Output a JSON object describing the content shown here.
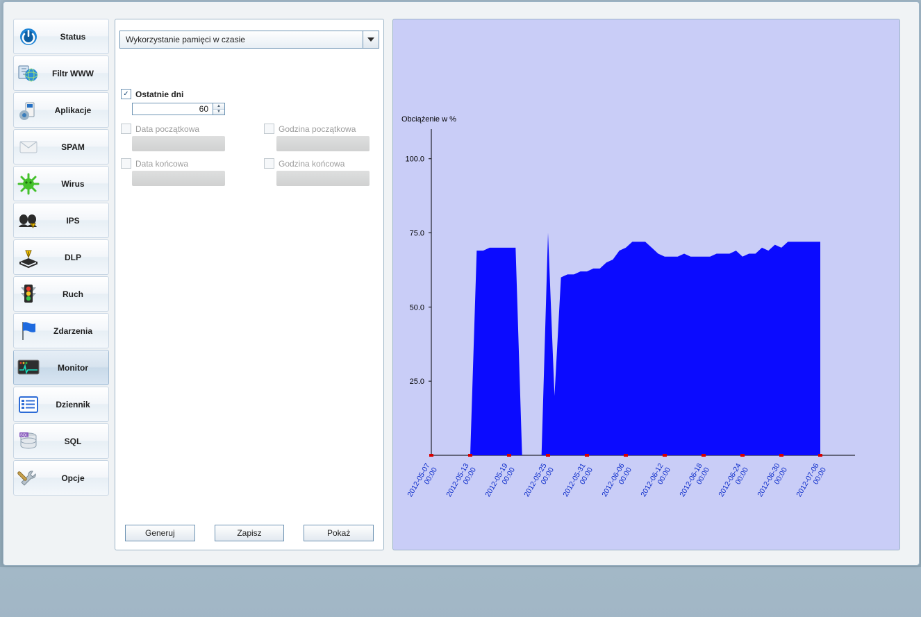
{
  "sidebar": {
    "items": [
      {
        "label": "Status",
        "icon": "power-icon"
      },
      {
        "label": "Filtr WWW",
        "icon": "globe-filter-icon"
      },
      {
        "label": "Aplikacje",
        "icon": "apps-icon"
      },
      {
        "label": "SPAM",
        "icon": "envelope-icon"
      },
      {
        "label": "Wirus",
        "icon": "virus-icon"
      },
      {
        "label": "IPS",
        "icon": "ips-icon"
      },
      {
        "label": "DLP",
        "icon": "dlp-book-icon"
      },
      {
        "label": "Ruch",
        "icon": "traffic-light-icon"
      },
      {
        "label": "Zdarzenia",
        "icon": "flag-icon"
      },
      {
        "label": "Monitor",
        "icon": "monitor-icon",
        "active": true
      },
      {
        "label": "Dziennik",
        "icon": "log-list-icon"
      },
      {
        "label": "SQL",
        "icon": "database-icon"
      },
      {
        "label": "Opcje",
        "icon": "tools-icon"
      }
    ]
  },
  "form": {
    "report_select_value": "Wykorzystanie pamięci w czasie",
    "last_days_label": "Ostatnie dni",
    "last_days_value": "60",
    "last_days_checked": true,
    "date_start_label": "Data początkowa",
    "time_start_label": "Godzina początkowa",
    "date_end_label": "Data końcowa",
    "time_end_label": "Godzina końcowa",
    "btn_generate": "Generuj",
    "btn_save": "Zapisz",
    "btn_show": "Pokaż"
  },
  "chart_data": {
    "type": "area",
    "title": "Obciążenie w %",
    "ylabel": "",
    "ylim": [
      0,
      110
    ],
    "yticks": [
      25.0,
      50.0,
      75.0,
      100.0
    ],
    "x_tick_labels": [
      "2012-05-07 00:00",
      "2012-05-13 00:00",
      "2012-05-19 00:00",
      "2012-05-25 00:00",
      "2012-05-31 00:00",
      "2012-06-06 00:00",
      "2012-06-12 00:00",
      "2012-06-18 00:00",
      "2012-06-24 00:00",
      "2012-06-30 00:00",
      "2012-07-06 00:00"
    ],
    "x": [
      0,
      1,
      2,
      3,
      4,
      5,
      6,
      7,
      8,
      9,
      10,
      11,
      12,
      13,
      14,
      15,
      16,
      17,
      18,
      19,
      20,
      21,
      22,
      23,
      24,
      25,
      26,
      27,
      28,
      29,
      30,
      31,
      32,
      33,
      34,
      35,
      36,
      37,
      38,
      39,
      40,
      41,
      42,
      43,
      44,
      45,
      46,
      47,
      48,
      49,
      50,
      51,
      52,
      53,
      54,
      55,
      56,
      57,
      58,
      59,
      60
    ],
    "values": [
      0,
      0,
      0,
      0,
      0,
      0,
      0,
      69,
      69,
      70,
      70,
      70,
      70,
      70,
      0,
      0,
      0,
      0,
      75,
      20,
      60,
      61,
      61,
      62,
      62,
      63,
      63,
      65,
      66,
      69,
      70,
      72,
      72,
      72,
      70,
      68,
      67,
      67,
      67,
      68,
      67,
      67,
      67,
      67,
      68,
      68,
      68,
      69,
      67,
      68,
      68,
      70,
      69,
      71,
      70,
      72,
      72,
      72,
      72,
      72,
      72
    ],
    "colors": {
      "area": "#0b0bff",
      "tick_red": "#d90000",
      "x_tick_text": "#0929c9",
      "bg": "#c9cdf7"
    }
  }
}
